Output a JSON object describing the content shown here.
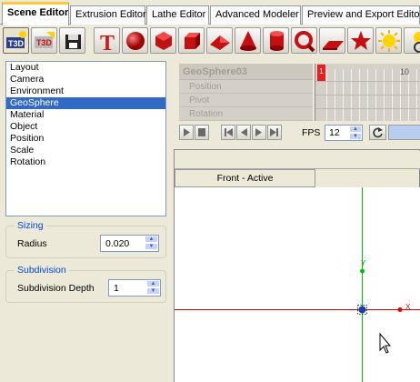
{
  "tabs": [
    {
      "label": "Scene Editor",
      "active": true
    },
    {
      "label": "Extrusion Editor",
      "active": false
    },
    {
      "label": "Lathe Editor",
      "active": false
    },
    {
      "label": "Advanced Modeler",
      "active": false
    },
    {
      "label": "Preview and Export Editor",
      "active": false
    }
  ],
  "toolbar": {
    "buttons": [
      {
        "icon": "t3d-logo-icon",
        "label": "T3D"
      },
      {
        "icon": "t3d-open-icon",
        "label": "T3D"
      },
      {
        "icon": "save-disk-icon"
      },
      {
        "icon": "text-t-icon",
        "label": "T"
      },
      {
        "icon": "sphere-icon"
      },
      {
        "icon": "geosphere-icon"
      },
      {
        "icon": "cube-icon"
      },
      {
        "icon": "pyramid-icon"
      },
      {
        "icon": "cone-icon"
      },
      {
        "icon": "cylinder-icon"
      },
      {
        "icon": "torus-icon"
      },
      {
        "icon": "plane-icon"
      },
      {
        "icon": "star-icon"
      },
      {
        "icon": "light-icon"
      },
      {
        "icon": "light-source-icon"
      }
    ]
  },
  "list": {
    "items": [
      "Layout",
      "Camera",
      "Environment",
      "GeoSphere",
      "Material",
      "Object",
      "Position",
      "Scale",
      "Rotation"
    ],
    "selected_index": 3
  },
  "sizing": {
    "title": "Sizing",
    "radius_label": "Radius",
    "radius_value": "0.020"
  },
  "subdivision": {
    "title": "Subdivision",
    "depth_label": "Subdivision Depth",
    "depth_value": "1"
  },
  "timeline": {
    "object_name": "GeoSphere03",
    "rows": [
      "Position",
      "Pivot",
      "Rotation"
    ],
    "current_frame": "1",
    "frame_ten": "10"
  },
  "playback": {
    "fps_label": "FPS",
    "fps_value": "12"
  },
  "viewport": {
    "tab_label": "Front - Active",
    "axis_x_label": "X",
    "axis_y_label": "Y"
  },
  "colors": {
    "accent": "#316ac5",
    "x_axis": "#e00000",
    "y_axis": "#00c000",
    "frame_marker": "#e81d1d"
  }
}
